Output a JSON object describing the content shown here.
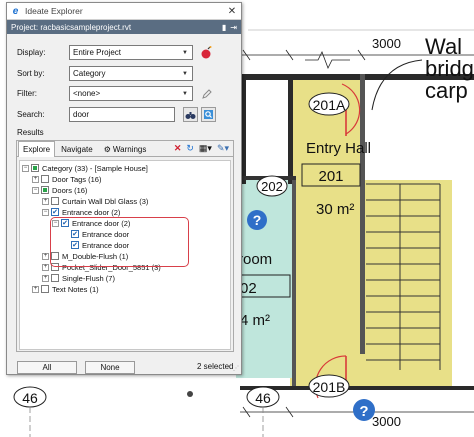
{
  "window": {
    "title": "Ideate Explorer",
    "close_glyph": "✕",
    "project_label": "Project: racbasicsampleproject.rvt"
  },
  "filters": {
    "display_label": "Display:",
    "display_value": "Entire Project",
    "sortby_label": "Sort by:",
    "sortby_value": "Category",
    "filter_label": "Filter:",
    "filter_value": "<none>",
    "search_label": "Search:",
    "search_value": "door"
  },
  "results": {
    "label": "Results",
    "tabs": [
      "Explore",
      "Navigate",
      "Warnings"
    ],
    "tree": [
      {
        "label": "Category (33) - [Sample House]"
      },
      {
        "label": "Door Tags (16)"
      },
      {
        "label": "Doors (16)"
      },
      {
        "label": "Curtain Wall Dbl Glass (3)"
      },
      {
        "label": "Entrance door (2)"
      },
      {
        "label": "Entrance door (2)"
      },
      {
        "label": "Entrance door"
      },
      {
        "label": "Entrance door"
      },
      {
        "label": "M_Double-Flush (1)"
      },
      {
        "label": "Pocket_Slider_Door_5851 (3)"
      },
      {
        "label": "Single-Flush (7)"
      },
      {
        "label": "Text Notes (1)"
      }
    ],
    "all_button": "All",
    "none_button": "None",
    "selected_count": "2 selected"
  },
  "drawing": {
    "dims": [
      "3000",
      "3000",
      "3000",
      "3000"
    ],
    "room_tags": [
      "201A",
      "202",
      "201B"
    ],
    "room_name": "Entry Hall",
    "room_number": "201",
    "room_area": "30 m²",
    "left_room_name": "room",
    "left_room_number": "02",
    "left_area": "4 m²",
    "grid_tags": [
      "46",
      "46",
      "46",
      "46"
    ],
    "note_lines": [
      "Wal",
      "bridg",
      "carp"
    ],
    "help_glyph": "?"
  },
  "colors": {
    "panel_bg": "#f0f0f0",
    "project_bar": "#5a6d82",
    "highlight": "#d8404a",
    "room_yellow": "#e8e088",
    "room_teal": "#bfe6dc",
    "help_blue": "#2f6fc8"
  }
}
